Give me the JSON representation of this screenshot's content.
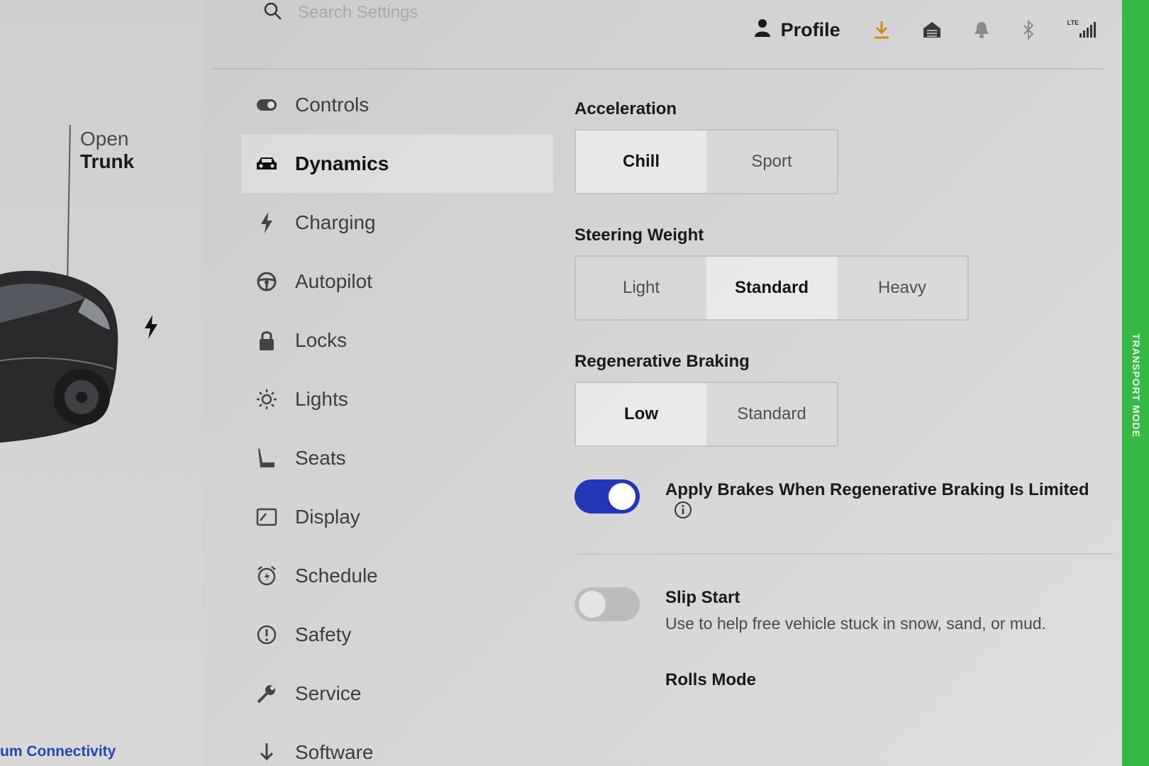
{
  "search": {
    "placeholder": "Search Settings"
  },
  "status": {
    "profile_label": "Profile",
    "icons": [
      "download-icon",
      "garage-icon",
      "bell-icon",
      "bluetooth-icon",
      "lte-signal-icon"
    ],
    "lte_label": "LTE",
    "download_color": "#d08a1a"
  },
  "car": {
    "open_label": "Open",
    "trunk_label": "Trunk",
    "premium_label": "um Connectivity"
  },
  "nav": {
    "items": [
      {
        "label": "Controls",
        "icon": "toggle-icon"
      },
      {
        "label": "Dynamics",
        "icon": "car-icon",
        "active": true
      },
      {
        "label": "Charging",
        "icon": "lightning-icon"
      },
      {
        "label": "Autopilot",
        "icon": "steering-wheel-icon"
      },
      {
        "label": "Locks",
        "icon": "lock-icon"
      },
      {
        "label": "Lights",
        "icon": "sun-icon"
      },
      {
        "label": "Seats",
        "icon": "seat-icon"
      },
      {
        "label": "Display",
        "icon": "display-icon"
      },
      {
        "label": "Schedule",
        "icon": "schedule-icon"
      },
      {
        "label": "Safety",
        "icon": "alert-circle-icon"
      },
      {
        "label": "Service",
        "icon": "wrench-icon"
      },
      {
        "label": "Software",
        "icon": "download-arrow-icon"
      }
    ]
  },
  "dynamics": {
    "acceleration": {
      "title": "Acceleration",
      "options": [
        "Chill",
        "Sport"
      ],
      "selected": "Chill"
    },
    "steering_weight": {
      "title": "Steering Weight",
      "options": [
        "Light",
        "Standard",
        "Heavy"
      ],
      "selected": "Standard"
    },
    "regen_braking": {
      "title": "Regenerative Braking",
      "options": [
        "Low",
        "Standard"
      ],
      "selected": "Low"
    },
    "apply_brakes": {
      "label": "Apply Brakes When Regenerative Braking Is Limited",
      "enabled": true
    },
    "slip_start": {
      "label": "Slip Start",
      "description": "Use to help free vehicle stuck in snow, sand, or mud.",
      "enabled": false
    },
    "rolls_mode": {
      "label": "Rolls Mode"
    }
  },
  "edge": {
    "label": "TRANSPORT MODE",
    "color": "#35b845"
  },
  "colors": {
    "toggle_on": "#2336b8",
    "accent_link": "#2346b8"
  }
}
